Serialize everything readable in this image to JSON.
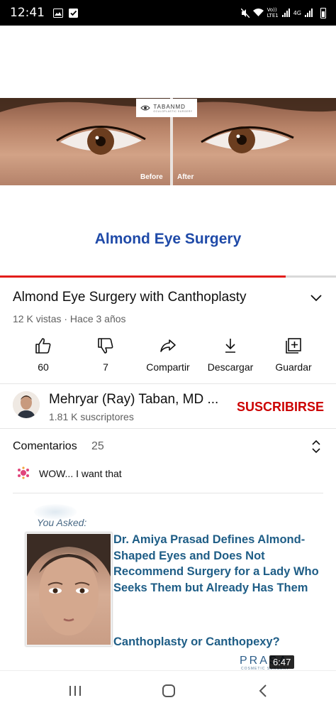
{
  "status_bar": {
    "time": "12:41",
    "left_icons": [
      "image-icon",
      "check-box-icon"
    ],
    "right_icons": [
      "mute-icon",
      "wifi-icon",
      "signal-icon",
      "signal-icon",
      "battery-icon"
    ],
    "volte_label": "Vo))\nLTE1",
    "net_label": "4G"
  },
  "player": {
    "brand": "TABANMD",
    "brand_sub": "OCULOPLASTIC SURGERY",
    "before_label": "Before",
    "after_label": "After",
    "overlay_title": "Almond Eye Surgery",
    "progress": 0.85,
    "progress_color": "#e31d1a"
  },
  "video": {
    "title": "Almond Eye Surgery with Canthoplasty",
    "meta": "12 K vistas · Hace 3 años"
  },
  "actions": [
    {
      "icon": "thumbs-up-icon",
      "label": "60"
    },
    {
      "icon": "thumbs-down-icon",
      "label": "7"
    },
    {
      "icon": "share-icon",
      "label": "Compartir"
    },
    {
      "icon": "download-icon",
      "label": "Descargar"
    },
    {
      "icon": "save-playlist-icon",
      "label": "Guardar"
    }
  ],
  "channel": {
    "name": "Mehryar (Ray) Taban, MD ...",
    "subscribers": "1.81 K suscriptores",
    "subscribe_label": "SUSCRIBIRSE",
    "accent": "#cc0000"
  },
  "comments": {
    "label": "Comentarios",
    "count": "25",
    "top_comment": "WOW... I want that"
  },
  "recommended": {
    "asked": "You Asked:",
    "headline": "Dr. Amiya Prasad Defines Almond-Shaped Eyes and Does Not Recommend Surgery for a Lady Who Seeks Them but Already Has Them",
    "subtitle": "Canthoplasty or Canthopexy?",
    "brand": "PRASA",
    "brand_sub": "COSMETIC SURGERY",
    "duration": "6:47",
    "text_color": "#1e5d86"
  },
  "nav": [
    "recent-apps-icon",
    "home-icon",
    "back-icon"
  ]
}
